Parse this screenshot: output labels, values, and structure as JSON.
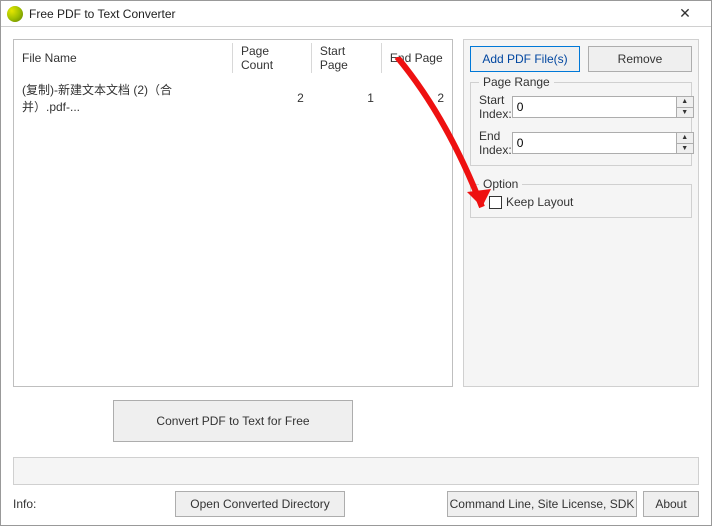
{
  "window": {
    "title": "Free PDF to Text Converter",
    "close": "✕"
  },
  "table": {
    "headers": {
      "file_name": "File Name",
      "page_count": "Page Count",
      "start_page": "Start Page",
      "end_page": "End Page"
    },
    "rows": [
      {
        "file_name": "(复制)-新建文本文档 (2)（合并）.pdf-...",
        "page_count": "2",
        "start_page": "1",
        "end_page": "2"
      }
    ]
  },
  "buttons": {
    "add": "Add PDF File(s)",
    "remove": "Remove",
    "convert": "Convert PDF to Text for Free",
    "opendir": "Open Converted Directory",
    "cmdline": "Command Line, Site License, SDK",
    "about": "About"
  },
  "page_range": {
    "legend": "Page Range",
    "start_label": "Start Index:",
    "end_label": "End Index:",
    "start_value": "0",
    "end_value": "0"
  },
  "option": {
    "legend": "Option",
    "keep_layout": "Keep Layout"
  },
  "info_label": "Info:"
}
